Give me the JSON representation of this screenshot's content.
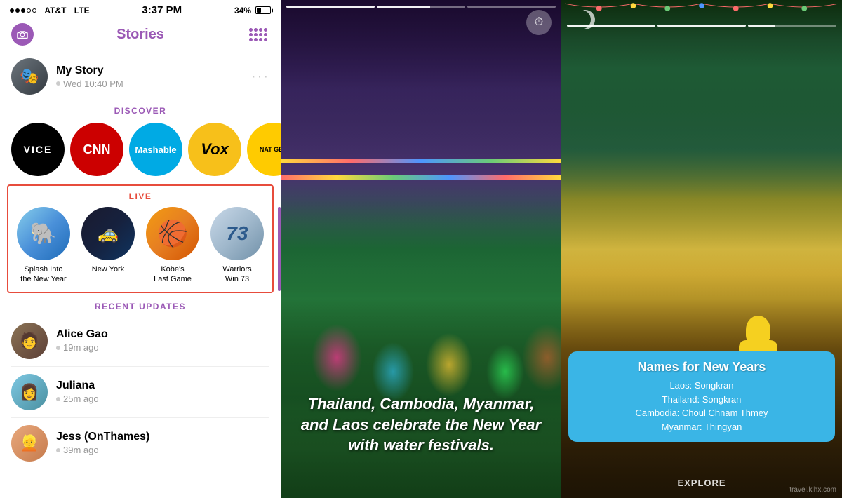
{
  "status_bar": {
    "carrier": "AT&T",
    "network": "LTE",
    "time": "3:37 PM",
    "battery_percent": "34%"
  },
  "header": {
    "title": "Stories",
    "left_icon": "camera-icon",
    "right_icon": "snap-grid-icon"
  },
  "my_story": {
    "name": "My Story",
    "timestamp": "Wed 10:40 PM",
    "avatar_emoji": "🎭"
  },
  "discover": {
    "label": "DISCOVER",
    "items": [
      {
        "name": "vice",
        "label": "VICE"
      },
      {
        "name": "cnn",
        "label": "CNN"
      },
      {
        "name": "mashable",
        "label": "Mashable"
      },
      {
        "name": "vox",
        "label": "Vox"
      },
      {
        "name": "natgeo",
        "label": "NAT GEO"
      }
    ]
  },
  "live": {
    "label": "LIVE",
    "items": [
      {
        "id": "splash",
        "label": "Splash Into\nthe New Year",
        "label_line1": "Splash Into",
        "label_line2": "the New Year"
      },
      {
        "id": "newyork",
        "label": "New York",
        "label_line1": "New",
        "label_line2": "York"
      },
      {
        "id": "kobe",
        "label": "Kobe's Last Game",
        "label_line1": "Kobe's",
        "label_line2": "Last Game"
      },
      {
        "id": "warriors",
        "label": "Warriors Win 73",
        "label_line1": "Warriors",
        "label_line2": "Win 73"
      }
    ]
  },
  "recent_updates": {
    "label": "RECENT UPDATES",
    "items": [
      {
        "name": "Alice Gao",
        "time": "19m ago"
      },
      {
        "name": "Juliana",
        "time": "25m ago"
      },
      {
        "name": "Jess (OnThames)",
        "time": "39m ago"
      }
    ]
  },
  "middle_panel": {
    "caption": "Thailand, Cambodia, Myanmar, and Laos celebrate the New Year with water festivals.",
    "timer_icon": "⏱"
  },
  "right_panel": {
    "info_title": "Names for New Years",
    "info_items": [
      "Laos: Songkran",
      "Thailand: Songkran",
      "Cambodia: Choul Chnam Thmey",
      "Myanmar: Thingyan"
    ],
    "explore_label": "EXPLORE",
    "watermark": "travel.klhx.com"
  }
}
